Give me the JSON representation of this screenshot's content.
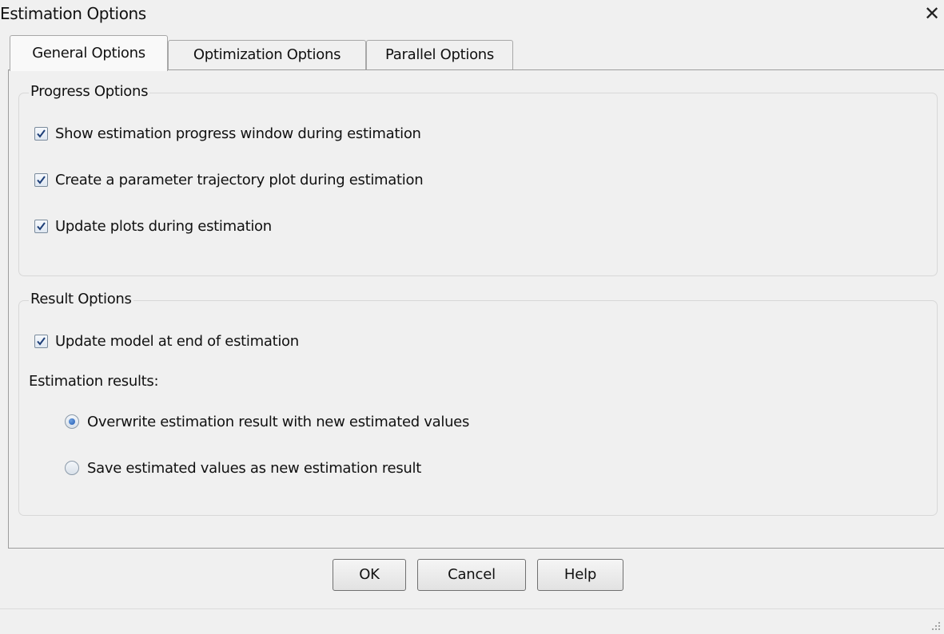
{
  "window": {
    "title": "Estimation Options",
    "close_glyph": "✕",
    "close_icon": "close-icon"
  },
  "tabs": [
    {
      "label": "General Options",
      "active": true
    },
    {
      "label": "Optimization Options",
      "active": false
    },
    {
      "label": "Parallel Options",
      "active": false
    }
  ],
  "progress_options": {
    "title": "Progress Options",
    "items": [
      {
        "label": "Show estimation progress window during estimation",
        "checked": true
      },
      {
        "label": "Create a parameter trajectory plot during estimation",
        "checked": true
      },
      {
        "label": "Update plots during estimation",
        "checked": true
      }
    ]
  },
  "result_options": {
    "title": "Result Options",
    "update_model": {
      "label": "Update model at end of estimation",
      "checked": true
    },
    "estimation_results_label": "Estimation results:",
    "radios": [
      {
        "label": "Overwrite estimation result with new estimated values",
        "selected": true
      },
      {
        "label": "Save estimated values as new estimation result",
        "selected": false
      }
    ]
  },
  "buttons": {
    "ok": "OK",
    "cancel": "Cancel",
    "help": "Help"
  },
  "colors": {
    "window_bg": "#f0f0f0",
    "checkmark": "#1e3f78",
    "radio_dot": "#1f58b3"
  }
}
